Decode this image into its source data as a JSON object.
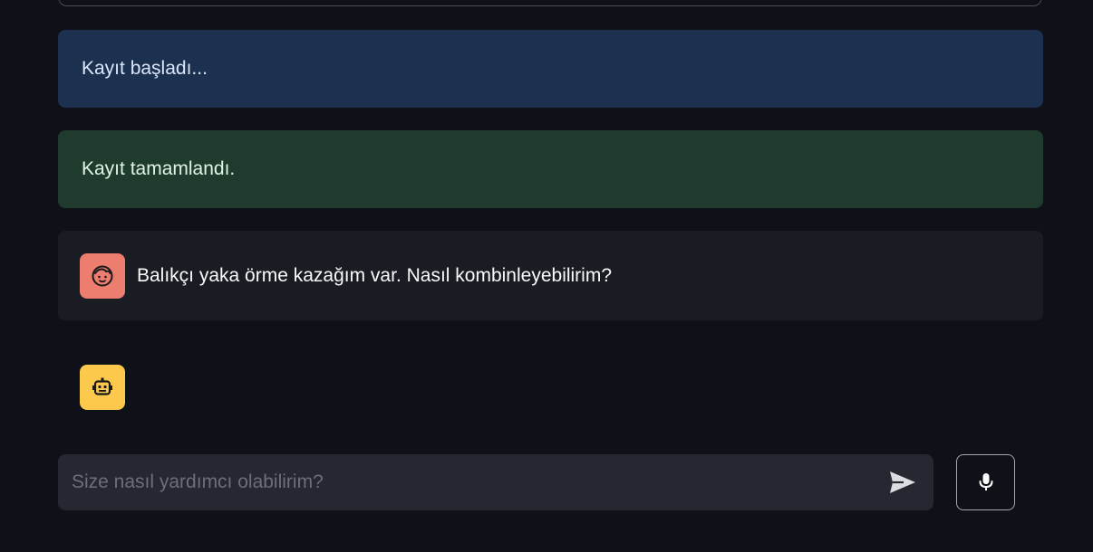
{
  "alerts": {
    "info_text": "Kayıt başladı...",
    "success_text": "Kayıt tamamlandı."
  },
  "chat": {
    "messages": [
      {
        "role": "user",
        "avatar_icon": "face-icon",
        "text": "Balıkçı yaka örme kazağım var. Nasıl kombinleyebilirim?"
      },
      {
        "role": "assistant",
        "avatar_icon": "robot-icon",
        "text": ""
      }
    ],
    "input_placeholder": "Size nasıl yardımcı olabilirim?",
    "send_icon": "send-icon",
    "mic_icon": "microphone-icon"
  },
  "colors": {
    "background": "#0e1117",
    "info_bg": "#1c3050",
    "success_bg": "#1f3b2d",
    "user_avatar": "#ed7d6f",
    "bot_avatar": "#fcc94d"
  }
}
